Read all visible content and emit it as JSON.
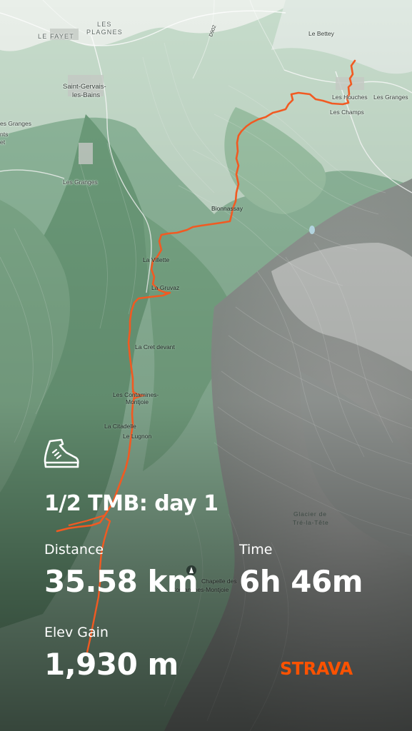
{
  "map": {
    "labels": {
      "le_fayet": "LE FAYET",
      "les_plagnes_1": "LES",
      "les_plagnes_2": "PLAGNES",
      "le_bettey": "Le Bettey",
      "saint_gervais_1": "Saint-Gervais-",
      "saint_gervais_2": "les-Bains",
      "les_houches": "Les Houches",
      "les_granges_ne": "Les Granges",
      "les_champs": "Les Champs",
      "les_granges_w": "es Granges",
      "nts": "nts",
      "et": "et",
      "les_granges_mid": "Les Granges",
      "bionnassay": "Bionnassay",
      "la_villette": "La Villette",
      "la_gruvaz": "La Gruvaz",
      "la_cret_devant": "La Cret devant",
      "les_contamines_1": "Les Contamines-",
      "les_contamines_2": "Montjoie",
      "la_citadelle": "La Citadelle",
      "le_lugnon": "Le Lugnon",
      "glacier_1": "Glacier de",
      "glacier_2": "Tré-la-Tête",
      "chapelle_1": "Chapelle des",
      "chapelle_2": "Contamines-Montjoie",
      "road_number": "D902"
    },
    "route_color": "#f15a22"
  },
  "activity": {
    "icon": "hiking-boot-icon",
    "title": "1/2 TMB: day 1",
    "stats": {
      "distance_label": "Distance",
      "distance_value": "35.58 km",
      "time_label": "Time",
      "time_value": "6h 46m",
      "elev_label": "Elev Gain",
      "elev_value": "1,930 m"
    }
  },
  "brand": {
    "name": "STRAVA",
    "color": "#fc5200"
  }
}
